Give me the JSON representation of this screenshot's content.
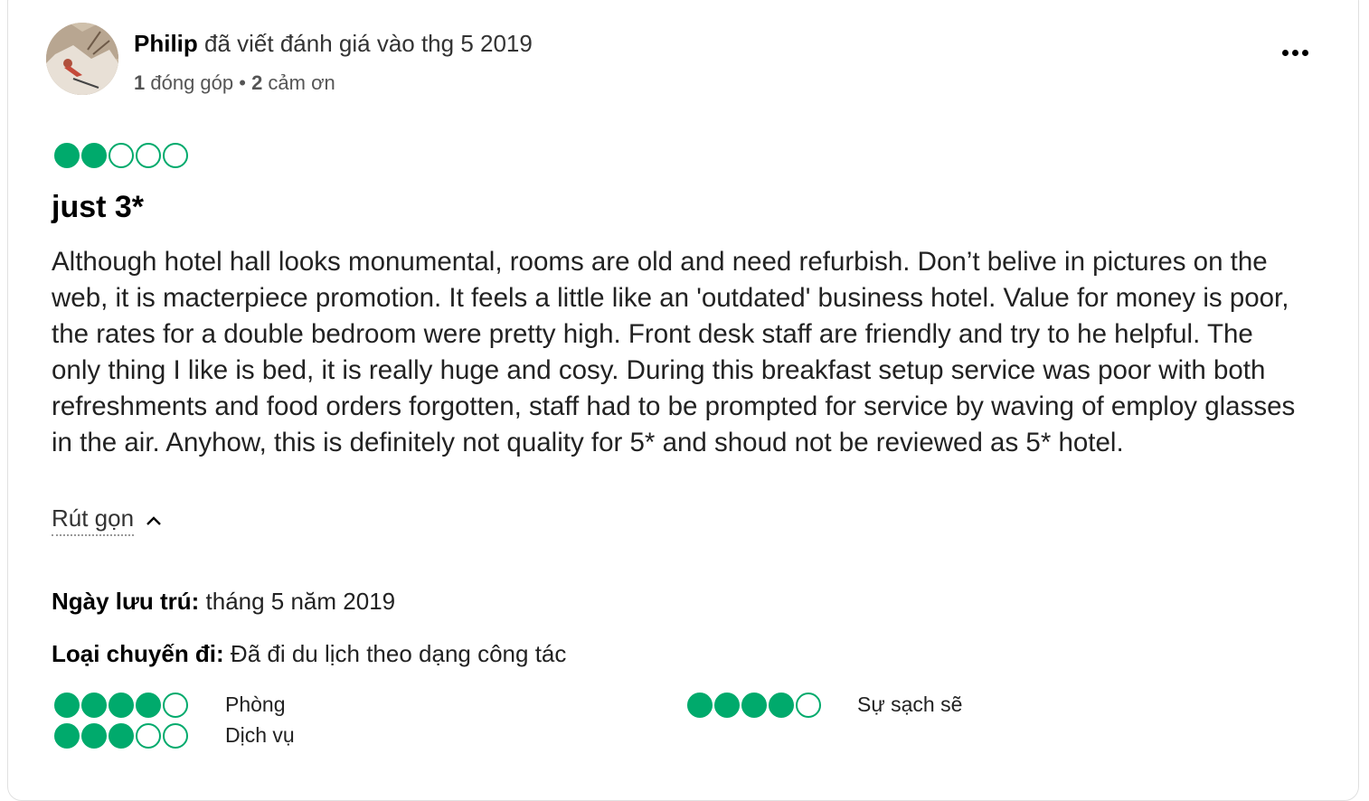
{
  "author": {
    "name": "Philip",
    "action": " đã viết đánh giá vào thg 5 2019",
    "contributions_count": "1",
    "contributions_label": " đóng góp",
    "separator": " • ",
    "thanks_count": "2",
    "thanks_label": " cảm ơn"
  },
  "review": {
    "rating": 2,
    "rating_max": 5,
    "title": "just 3*",
    "body": "Although hotel hall looks monumental, rooms are old and need refurbish. Don’t belive in pictures on the web, it is macterpiece promotion. It feels a little like an 'outdated' business hotel. Value for money is poor, the rates for a double bedroom were pretty high. Front desk staff are friendly and try to he helpful. The only thing I like is bed, it is really huge and cosy. During this breakfast setup service was poor with both refreshments and food orders forgotten, staff had to be prompted for service by waving of employ glasses in the air. Anyhow, this is definitely not quality for 5* and shoud not be reviewed as 5* hotel.",
    "collapse_label": "Rút gọn"
  },
  "stay": {
    "date_label": "Ngày lưu trú:",
    "date_value": " tháng 5 năm 2019",
    "trip_type_label": "Loại chuyến đi:",
    "trip_type_value": " Đã đi du lịch theo dạng công tác"
  },
  "sub_ratings": [
    {
      "label": "Phòng",
      "rating": 4
    },
    {
      "label": "Sự sạch sẽ",
      "rating": 4
    },
    {
      "label": "Dịch vụ",
      "rating": 3
    }
  ],
  "colors": {
    "bubble": "#00aa6c"
  },
  "icons": {
    "more": "more-horizontal-icon",
    "collapse": "chevron-up-icon"
  }
}
